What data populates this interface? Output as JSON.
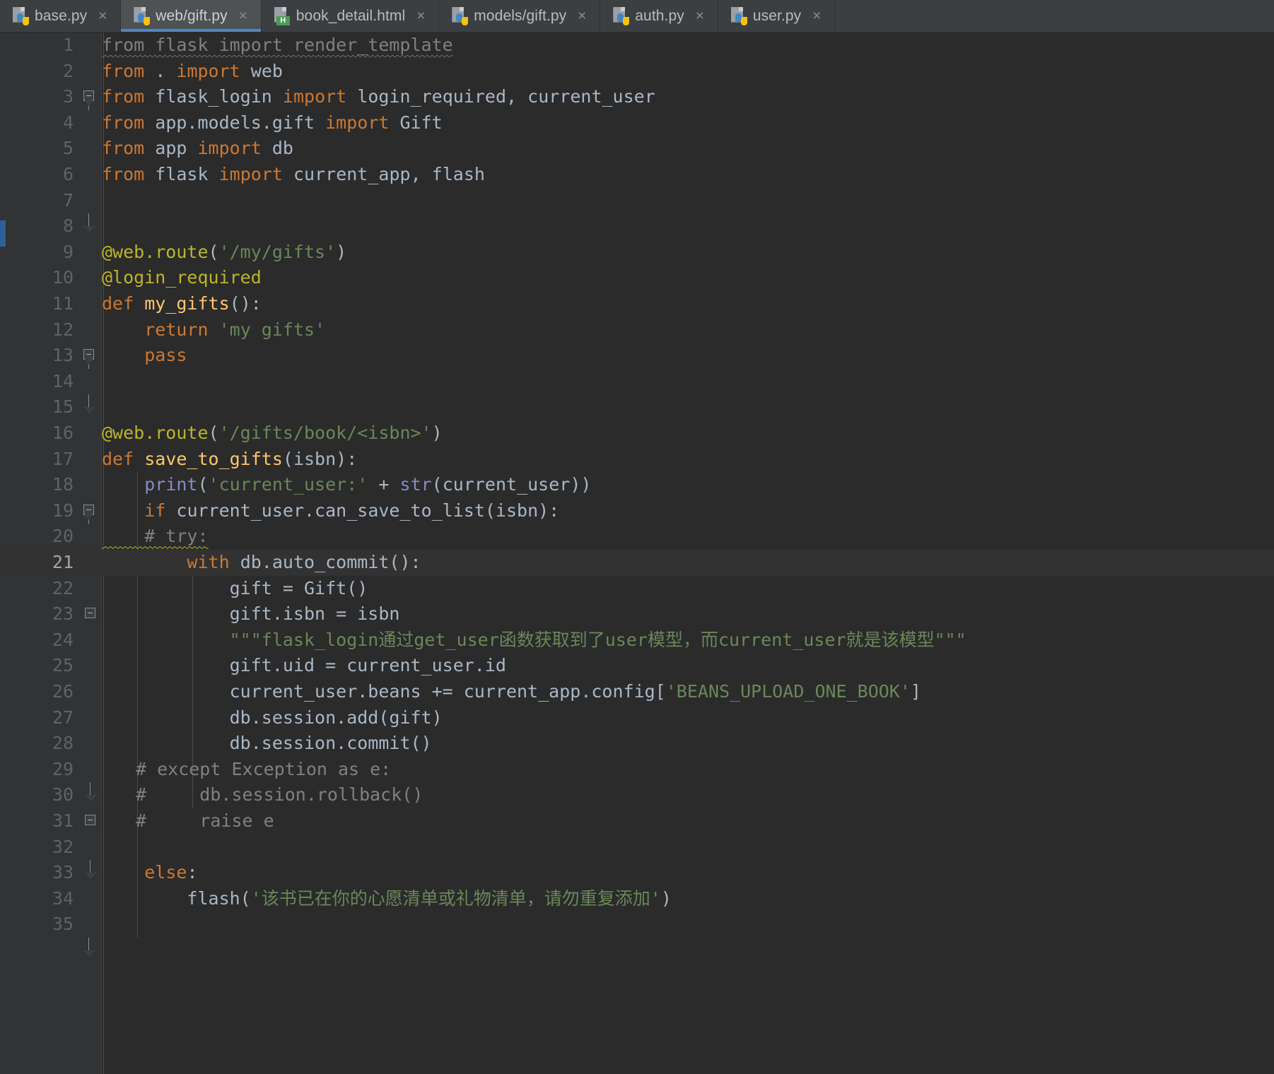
{
  "window": {
    "theme": "darcula",
    "accent_color": "#4a88c7",
    "background": "#2b2b2b",
    "gutter_background": "#313335"
  },
  "tabbar": {
    "tabs": [
      {
        "label": "base.py",
        "icon": "python-file-icon",
        "active": false,
        "close_glyph": "×"
      },
      {
        "label": "web/gift.py",
        "icon": "python-file-icon",
        "active": true,
        "close_glyph": "×"
      },
      {
        "label": "book_detail.html",
        "icon": "html-file-icon",
        "active": false,
        "close_glyph": "×"
      },
      {
        "label": "models/gift.py",
        "icon": "python-file-icon",
        "active": false,
        "close_glyph": "×"
      },
      {
        "label": "auth.py",
        "icon": "python-file-icon",
        "active": false,
        "close_glyph": "×"
      },
      {
        "label": "user.py",
        "icon": "python-file-icon",
        "active": false,
        "close_glyph": "×"
      }
    ],
    "html_badge_text": "H"
  },
  "editor": {
    "current_line": 21,
    "line_numbers": [
      "1",
      "2",
      "3",
      "4",
      "5",
      "6",
      "7",
      "8",
      "9",
      "10",
      "11",
      "12",
      "13",
      "14",
      "15",
      "16",
      "17",
      "18",
      "19",
      "20",
      "21",
      "22",
      "23",
      "24",
      "25",
      "26",
      "27",
      "28",
      "29",
      "30",
      "31",
      "32",
      "33",
      "34",
      "35"
    ],
    "lines": {
      "l1": "from flask import render_template",
      "l2": "from . import web",
      "l3": "from flask_login import login_required, current_user",
      "l4": "from app.models.gift import Gift",
      "l5": "from app import db",
      "l6": "from flask import current_app, flash",
      "l7": "",
      "l8": "",
      "l9": "@web.route('/my/gifts')",
      "l10": "@login_required",
      "l11": "def my_gifts():",
      "l12": "    return 'my gifts'",
      "l13": "    pass",
      "l14": "",
      "l15": "",
      "l16": "@web.route('/gifts/book/<isbn>')",
      "l17": "def save_to_gifts(isbn):",
      "l18": "    print('current_user:' + str(current_user))",
      "l19": "    if current_user.can_save_to_list(isbn):",
      "l20": "    # try:",
      "l21": "        with db.auto_commit():",
      "l22": "            gift = Gift()",
      "l23": "            gift.isbn = isbn",
      "l24": "            \"\"\"flask_login通过get_user函数获取到了user模型，而current_user就是该模型\"\"\"",
      "l25": "            gift.uid = current_user.id",
      "l26": "            current_user.beans += current_app.config['BEANS_UPLOAD_ONE_BOOK']",
      "l27": "            db.session.add(gift)",
      "l28": "            db.session.commit()",
      "l29": "    # except Exception as e:",
      "l30": "    #     db.session.rollback()",
      "l31": "    #     raise e",
      "l32": "",
      "l33": "    else:",
      "l34": "        flash('该书已在你的心愿清单或礼物清单，请勿重复添加')",
      "l35": ""
    },
    "tokens": {
      "kw_from": "from",
      "kw_import": "import",
      "kw_def": "def",
      "kw_return": "return",
      "kw_pass": "pass",
      "kw_if": "if",
      "kw_else": "else",
      "kw_with": "with",
      "mod_flask": "flask",
      "mod_render_template": "render_template",
      "mod_dot": ".",
      "mod_web": "web",
      "mod_flask_login": "flask_login",
      "id_login_required": "login_required",
      "id_current_user": "current_user",
      "mod_app_models_gift": "app.models.gift",
      "cls_Gift": "Gift",
      "mod_app": "app",
      "id_db": "db",
      "id_current_app": "current_app",
      "id_flash": "flash",
      "dec_web_route": "@web.route",
      "str_my_gifts_route": "'/my/gifts'",
      "dec_login_required": "@login_required",
      "fn_my_gifts": "my_gifts",
      "str_my_gifts": "'my gifts'",
      "str_gifts_book_isbn": "'/gifts/book/<isbn>'",
      "fn_save_to_gifts": "save_to_gifts",
      "arg_isbn": "isbn",
      "bfn_print": "print",
      "bfn_str": "str",
      "str_current_user_label": "'current_user:'",
      "op_plus": "+",
      "call_can_save_to_list": ".can_save_to_list",
      "cmt_try": "# try:",
      "call_auto_commit": "db.auto_commit()",
      "var_gift": "gift",
      "attr_isbn": ".isbn",
      "docstring_cn": "\"\"\"flask_login通过get_user函数获取到了user模型，而current_user就是该模型\"\"\"",
      "attr_uid": ".uid",
      "attr_id": ".id",
      "attr_beans": ".beans",
      "op_plus_eq": "+=",
      "attr_config": ".config",
      "str_beans_const": "'BEANS_UPLOAD_ONE_BOOK'",
      "call_session_add": "db.session.add(gift)",
      "call_session_commit": "db.session.commit()",
      "cmt_except": "# except Exception as e:",
      "cmt_rollback": "#     db.session.rollback()",
      "cmt_raise": "#     raise e",
      "str_flash_cn": "'该书已在你的心愿清单或礼物清单，请勿重复添加'"
    },
    "colors": {
      "keyword": "#cc7832",
      "string": "#6a8759",
      "decorator": "#bbb529",
      "function": "#ffc66d",
      "builtin": "#8888c6",
      "comment": "#808080",
      "identifier": "#a9b7c6",
      "line_number": "#606366",
      "current_line_bg": "#323232"
    }
  }
}
